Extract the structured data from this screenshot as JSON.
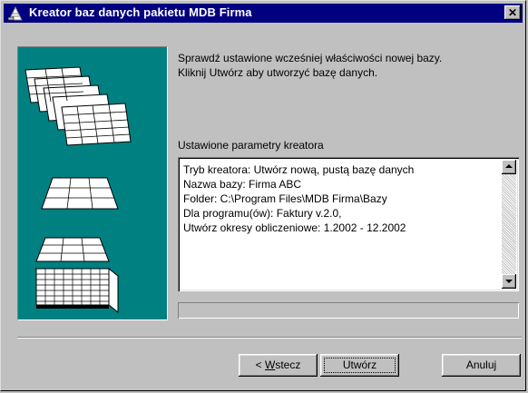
{
  "window": {
    "title": "Kreator baz danych pakietu MDB Firma",
    "close_glyph": "✕",
    "app_icon": "database-wizard-icon"
  },
  "illustration": {
    "name": "database-tables-illustration",
    "background": "#008080"
  },
  "description": {
    "line1": "Sprawdź ustawione wcześniej właściwości nowej bazy.",
    "line2": "Kliknij Utwórz aby utworzyć bazę danych."
  },
  "params": {
    "label": "Ustawione parametry kreatora",
    "lines": [
      "Tryb kreatora: Utwórz nową, pustą bazę danych",
      "Nazwa bazy: Firma ABC",
      "Folder: C:\\Program Files\\MDB Firma\\Bazy",
      "Dla programu(ów): Faktury v.2.0,",
      "Utwórz okresy obliczeniowe: 1.2002 - 12.2002"
    ]
  },
  "buttons": {
    "back_prefix": "< ",
    "back_mnemonic": "W",
    "back_rest": "stecz",
    "create": "Utwórz",
    "cancel": "Anuluj"
  },
  "colors": {
    "titlebar": "#000080",
    "face": "#c0c0c0"
  }
}
